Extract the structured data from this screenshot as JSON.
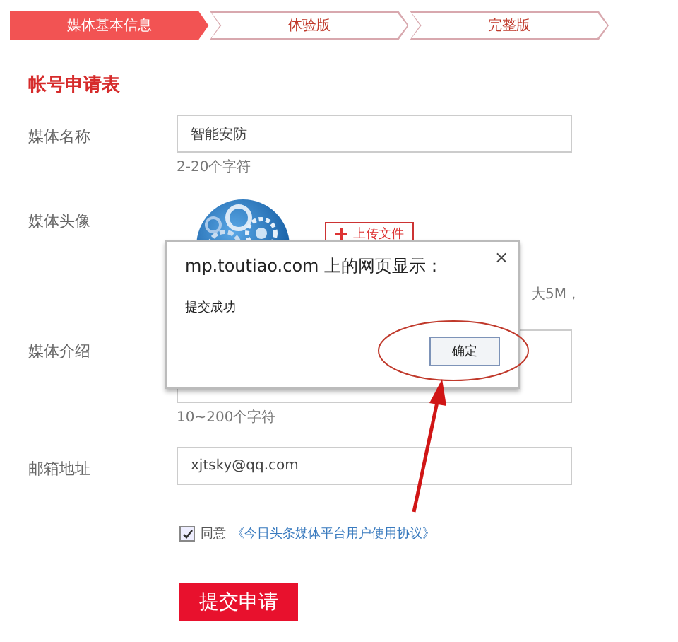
{
  "steps": [
    {
      "label": "媒体基本信息",
      "selected": true
    },
    {
      "label": "体验版",
      "selected": false
    },
    {
      "label": "完整版",
      "selected": false
    }
  ],
  "form_title": "帐号申请表",
  "fields": [
    {
      "kind": "text",
      "label": "媒体名称",
      "value": "智能安防",
      "hint": "2-20个字符"
    },
    {
      "kind": "avatar",
      "label": "媒体头像",
      "button": "上传文件",
      "hint": "大5M，"
    },
    {
      "kind": "textarea",
      "label": "媒体介绍",
      "hint": "10~200个字符"
    },
    {
      "kind": "text",
      "label": "邮箱地址",
      "value": "xjtsky@qq.com"
    }
  ],
  "agreement": {
    "checked": true,
    "text": "同意",
    "link": "《今日头条媒体平台用户使用协议》"
  },
  "submit": "提交申请",
  "dialog": {
    "title": "mp.toutiao.com 上的网页显示：",
    "close": "×",
    "message": "提交成功",
    "ok": "确定"
  }
}
